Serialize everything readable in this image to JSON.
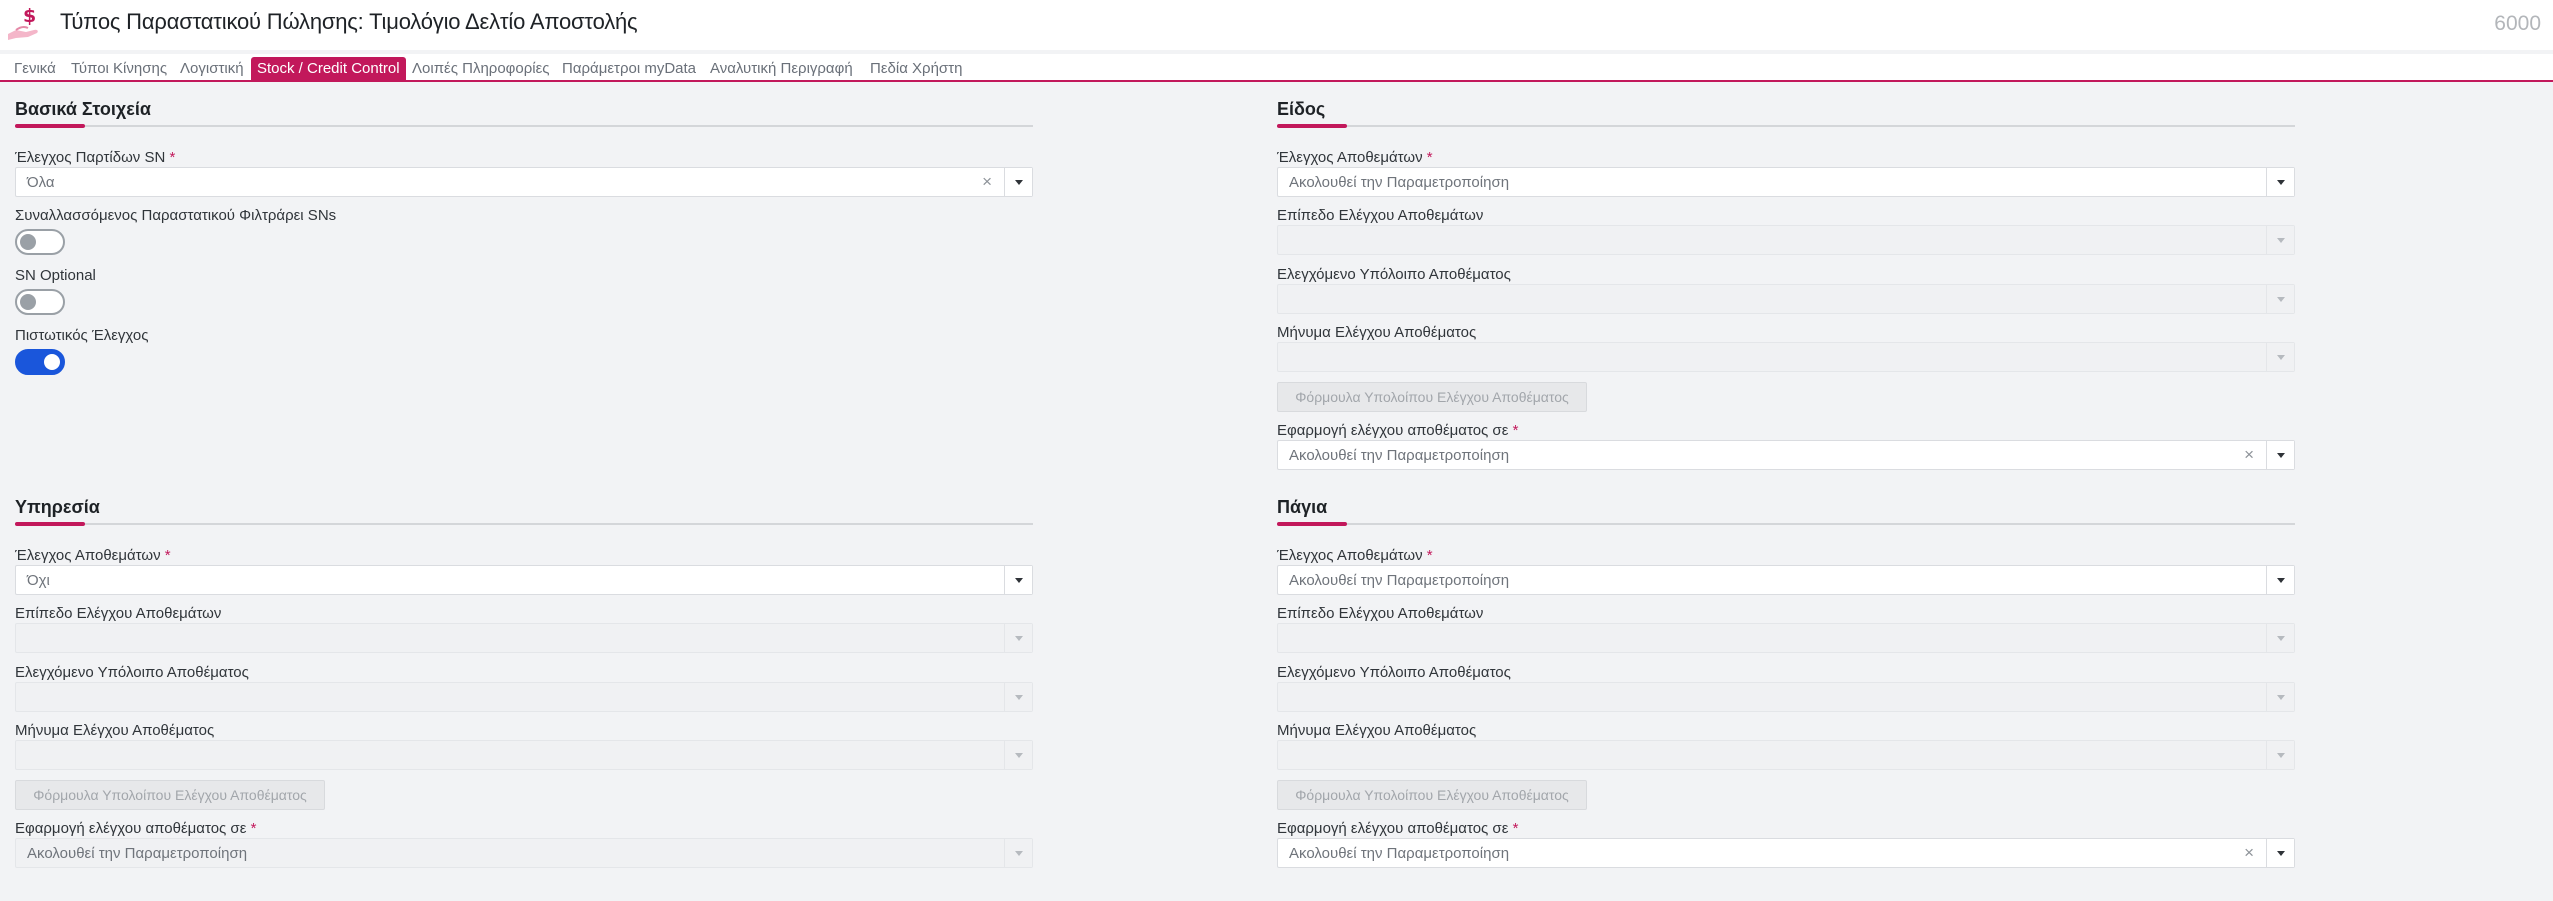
{
  "header": {
    "title": "Τύπος Παραστατικού Πώλησης: Τιμολόγιο Δελτίο Αποστολής",
    "doc_number": "6000",
    "icon": "hand-money-icon"
  },
  "tabs": [
    {
      "label": "Γενικά",
      "active": false
    },
    {
      "label": "Τύποι Κίνησης",
      "active": false
    },
    {
      "label": "Λογιστική",
      "active": false
    },
    {
      "label": "Stock / Credit Control",
      "active": true
    },
    {
      "label": "Λοιπές Πληροφορίες",
      "active": false
    },
    {
      "label": "Παράμετροι myData",
      "active": false
    },
    {
      "label": "Αναλυτική Περιγραφή",
      "active": false
    },
    {
      "label": "Πεδία Χρήστη",
      "active": false
    }
  ],
  "basic": {
    "title": "Βασικά Στοιχεία",
    "sn_label": "Έλεγχος Παρτίδων SN",
    "sn_value": "Όλα",
    "filter_label": "Συναλλασσόμενος Παραστατικού Φιλτράρει SNs",
    "filter_on": false,
    "optional_label": "SN Optional",
    "optional_on": false,
    "credit_label": "Πιστωτικός Έλεγχος",
    "credit_on": true
  },
  "eidos": {
    "title": "Είδος",
    "stock_label": "Έλεγχος Αποθεμάτων",
    "stock_value": "Ακολουθεί την Παραμετροποίηση",
    "level_label": "Επίπεδο Ελέγχου Αποθεμάτων",
    "level_value": "",
    "balance_label": "Ελεγχόμενο Υπόλοιπο Αποθέματος",
    "balance_value": "",
    "message_label": "Μήνυμα Ελέγχου Αποθέματος",
    "message_value": "",
    "formula_label": "Φόρμουλα Υπολοίπου Ελέγχου Αποθέματος",
    "apply_label": "Εφαρμογή ελέγχου αποθέματος σε",
    "apply_value": "Ακολουθεί την Παραμετροποίηση"
  },
  "service": {
    "title": "Υπηρεσία",
    "stock_label": "Έλεγχος Αποθεμάτων",
    "stock_value": "Όχι",
    "level_label": "Επίπεδο Ελέγχου Αποθεμάτων",
    "level_value": "",
    "balance_label": "Ελεγχόμενο Υπόλοιπο Αποθέματος",
    "balance_value": "",
    "message_label": "Μήνυμα Ελέγχου Αποθέματος",
    "message_value": "",
    "formula_label": "Φόρμουλα Υπολοίπου Ελέγχου Αποθέματος",
    "apply_label": "Εφαρμογή ελέγχου αποθέματος σε",
    "apply_value": "Ακολουθεί την Παραμετροποίηση"
  },
  "fixed": {
    "title": "Πάγια",
    "stock_label": "Έλεγχος Αποθεμάτων",
    "stock_value": "Ακολουθεί την Παραμετροποίηση",
    "level_label": "Επίπεδο Ελέγχου Αποθεμάτων",
    "level_value": "",
    "balance_label": "Ελεγχόμενο Υπόλοιπο Αποθέματος",
    "balance_value": "",
    "message_label": "Μήνυμα Ελέγχου Αποθέματος",
    "message_value": "",
    "formula_label": "Φόρμουλα Υπολοίπου Ελέγχου Αποθέματος",
    "apply_label": "Εφαρμογή ελέγχου αποθέματος σε",
    "apply_value": "Ακολουθεί την Παραμετροποίηση"
  },
  "required_mark": "*",
  "clear_glyph": "×",
  "colors": {
    "accent": "#c2185b",
    "toggle_on": "#1a56db"
  }
}
